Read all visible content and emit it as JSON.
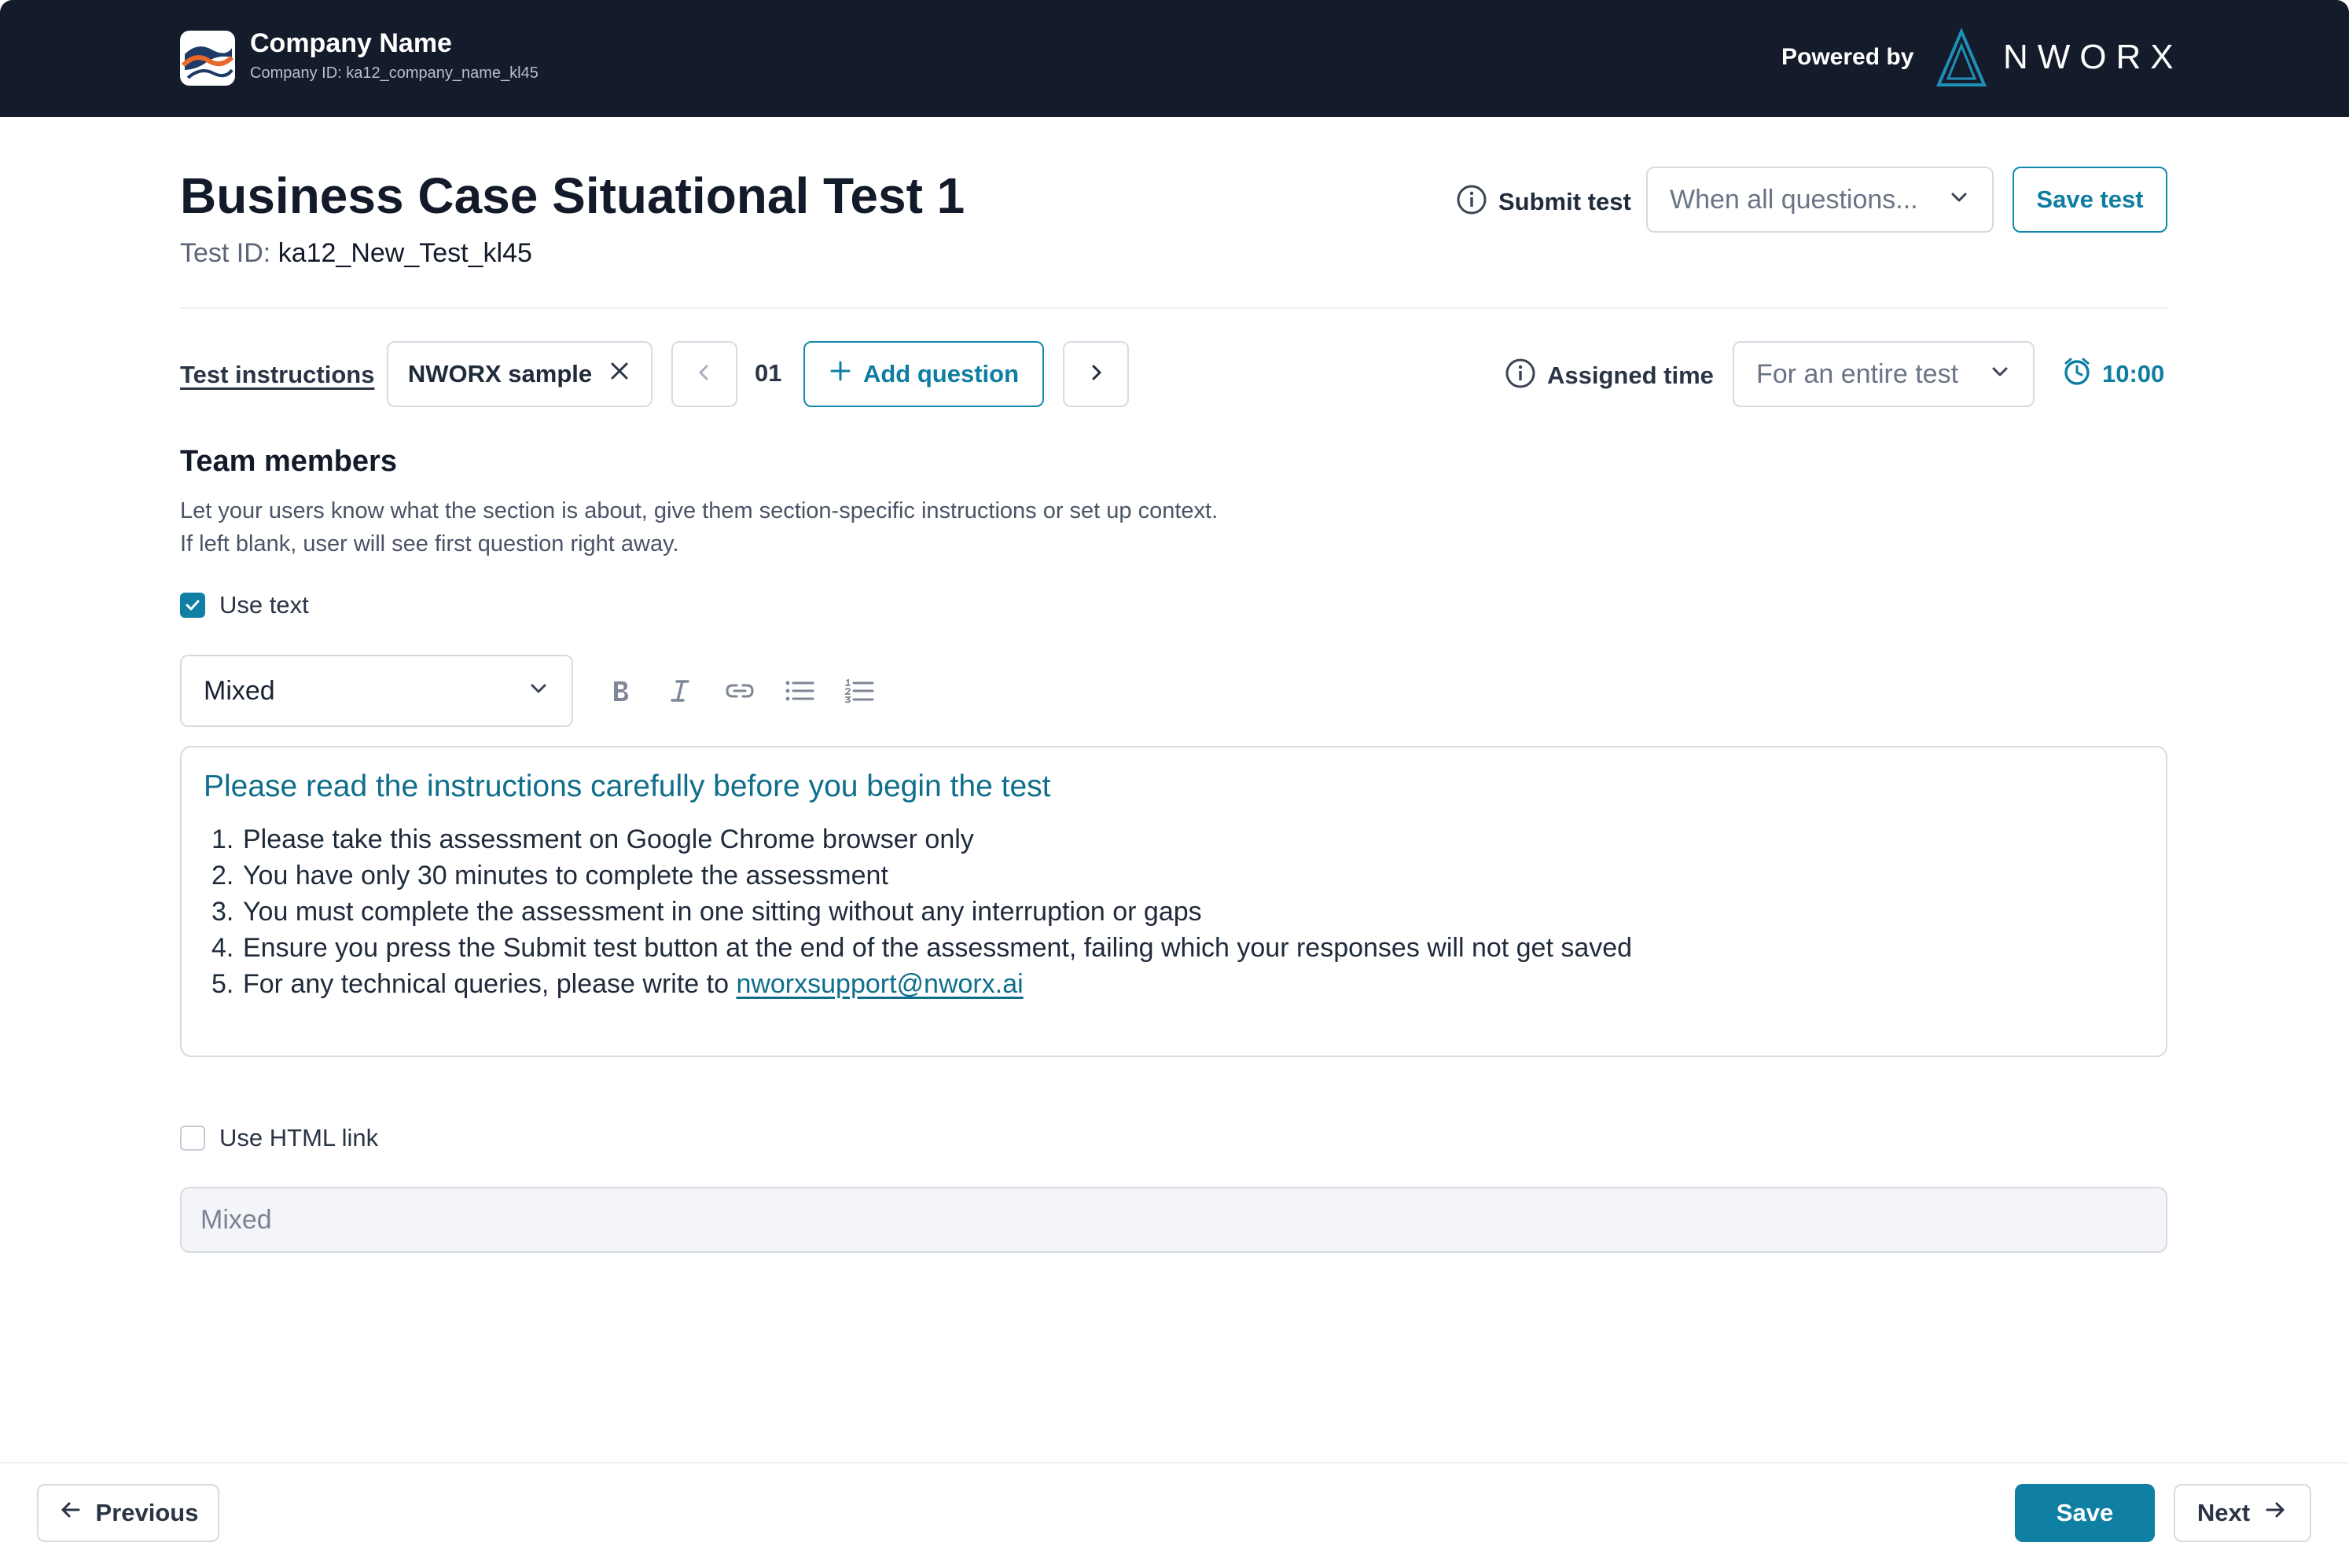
{
  "header": {
    "company_name": "Company Name",
    "company_id": "Company ID: ka12_company_name_kl45",
    "powered_by": "Powered by",
    "brand": "NWORX",
    "background": "#141b2a"
  },
  "title": {
    "text": "Business Case Situational Test 1",
    "test_id_label": "Test ID:",
    "test_id_value": "ka12_New_Test_kl45"
  },
  "submit": {
    "label": "Submit test",
    "select_value": "When all questions...",
    "save_test_label": "Save test"
  },
  "question_nav": {
    "instructions_link": "Test instructions",
    "chip_label": "NWORX sample",
    "question_number": "01",
    "add_question_label": "Add question",
    "assigned_time_label": "Assigned time",
    "assigned_time_select": "For an entire test",
    "timer_value": "10:00"
  },
  "section": {
    "title": "Team members",
    "desc_line1": "Let your users know what the section is about, give them section-specific instructions or set up context.",
    "desc_line2": "If left blank, user will see first question right away.",
    "use_text_label": "Use text",
    "use_text_checked": true,
    "format_select": "Mixed",
    "toolbar_icons": [
      "bold-icon",
      "italic-icon",
      "link-icon",
      "bullet-list-icon",
      "numbered-list-icon"
    ]
  },
  "editor": {
    "heading": "Please read the instructions carefully before you begin the test",
    "items": [
      "Please take this assessment on Google Chrome browser only",
      "You have only 30 minutes to complete the assessment",
      "You must complete the assessment in one sitting without any interruption or gaps",
      "Ensure you press the Submit test button at the end of the assessment, failing which your responses will not get saved",
      "For any technical queries, please write to"
    ],
    "email": "nworxsupport@nworx.ai"
  },
  "html_link": {
    "label": "Use HTML link",
    "checked": false,
    "input_value": "Mixed"
  },
  "footer": {
    "previous_label": "Previous",
    "save_label": "Save",
    "next_label": "Next"
  },
  "colors": {
    "accent": "#0f7fa3",
    "accent_text": "#0d7ea1",
    "heading_teal": "#0e6e8c"
  }
}
